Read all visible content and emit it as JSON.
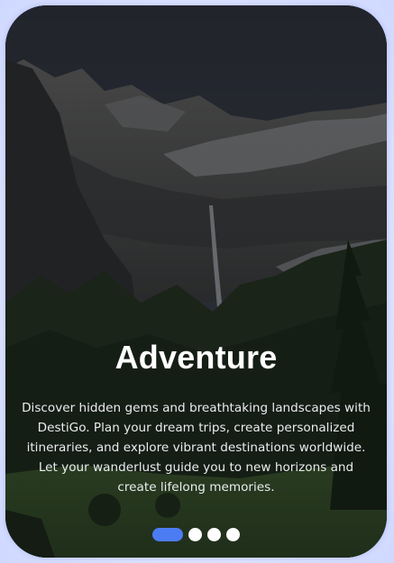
{
  "slide": {
    "title": "Adventure",
    "description": "Discover hidden gems and breathtaking landscapes with DestiGo. Plan your dream trips, create personalized itineraries, and explore vibrant destinations worldwide. Let your wanderlust guide you to new horizons and create lifelong memories.",
    "background_image": "mountain-valley-waterfall-photo"
  },
  "pager": {
    "total": 4,
    "active_index": 0,
    "active_color": "#4c7cf3",
    "inactive_color": "#ffffff"
  }
}
